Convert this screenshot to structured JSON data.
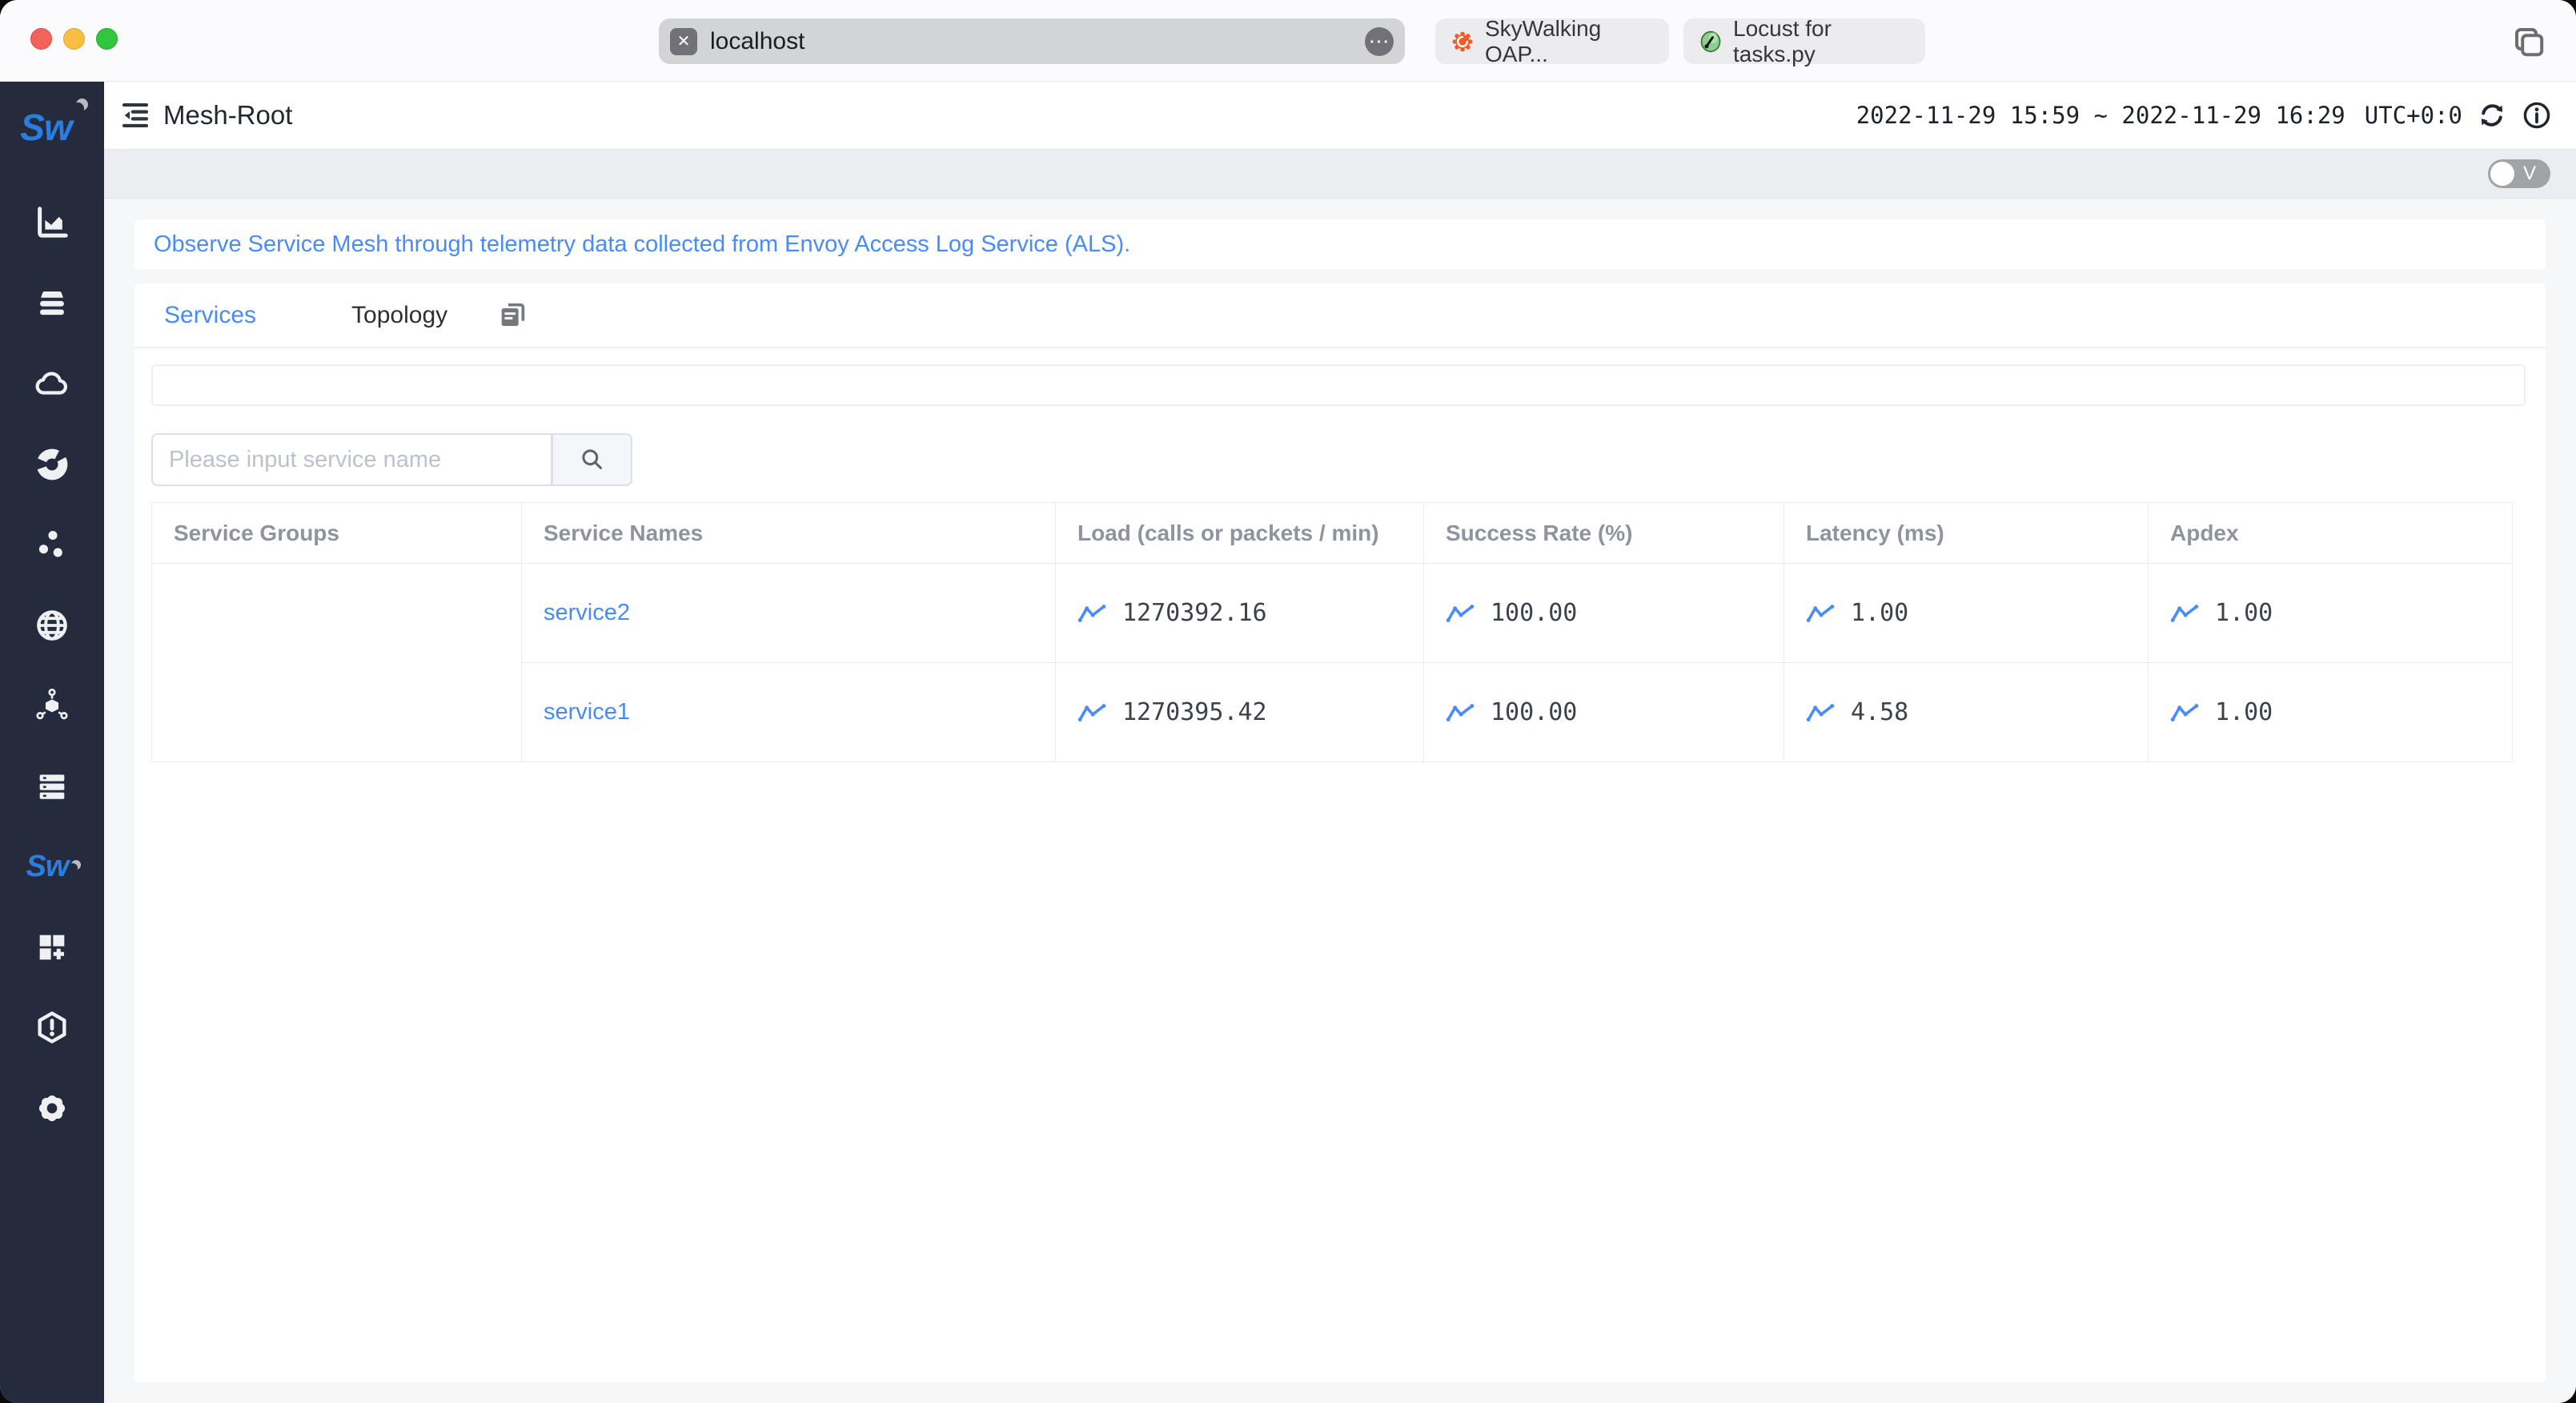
{
  "browser": {
    "url": "localhost",
    "pinned_tabs": [
      {
        "label": "SkyWalking OAP...",
        "icon": "grafana-icon"
      },
      {
        "label": "Locust for tasks.py",
        "icon": "locust-icon"
      }
    ]
  },
  "header": {
    "title": "Mesh-Root",
    "time_range": "2022-11-29 15:59 ~ 2022-11-29 16:29",
    "utc": "UTC+0:0"
  },
  "toolbar": {
    "mode_toggle_label": "V"
  },
  "notice": {
    "text": "Observe Service Mesh through telemetry data collected from Envoy Access Log Service (ALS)."
  },
  "content_tabs": {
    "services_label": "Services",
    "topology_label": "Topology"
  },
  "search": {
    "placeholder": "Please input service name"
  },
  "table": {
    "columns": [
      "Service Groups",
      "Service Names",
      "Load (calls or packets / min)",
      "Success Rate (%)",
      "Latency (ms)",
      "Apdex"
    ],
    "rows": [
      {
        "group": "",
        "name": "service2",
        "load": "1270392.16",
        "success_rate": "100.00",
        "latency": "1.00",
        "apdex": "1.00"
      },
      {
        "group": "",
        "name": "service1",
        "load": "1270395.42",
        "success_rate": "100.00",
        "latency": "4.58",
        "apdex": "1.00"
      }
    ]
  },
  "sidebar": {
    "logo": "Sw",
    "items": [
      "bar-chart-icon",
      "database-icon",
      "cloud-icon",
      "donut-chart-icon",
      "scatter-icon",
      "globe-icon",
      "service-mesh-icon",
      "infrastructure-icon",
      "skywalking-icon",
      "new-dashboard-icon",
      "alarm-hexagon-icon",
      "gear-icon"
    ]
  },
  "colors": {
    "accent_blue": "#478cf4",
    "sidebar_bg": "#252b3d",
    "grafana_orange": "#f05a28",
    "locust_green": "#8fce8f",
    "toolbar_gray": "#ebedf0"
  }
}
